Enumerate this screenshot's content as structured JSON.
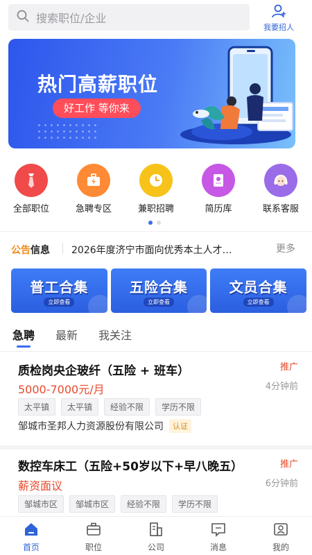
{
  "search": {
    "placeholder": "搜索职位/企业"
  },
  "recruit": {
    "label": "我要招人"
  },
  "banner": {
    "title": "热门高薪职位",
    "slogan": "好工作 等你来"
  },
  "categories": [
    {
      "label": "全部职位",
      "icon": "tie-icon",
      "color": "#f04a4a"
    },
    {
      "label": "急聘专区",
      "icon": "briefcase-bolt-icon",
      "color": "#ff8a35"
    },
    {
      "label": "兼职招聘",
      "icon": "clock-icon",
      "color": "#f7c31a"
    },
    {
      "label": "简历库",
      "icon": "resume-icon",
      "color": "#c757e5"
    },
    {
      "label": "联系客服",
      "icon": "headset-icon",
      "color": "#9b6ce8"
    }
  ],
  "notice": {
    "brand_a": "公告",
    "brand_b": "信息",
    "text": "2026年度济宁市面向优秀本土人才…",
    "more": "更多"
  },
  "collections": [
    {
      "title": "普工合集",
      "sub": "立即查看"
    },
    {
      "title": "五险合集",
      "sub": "立即查看"
    },
    {
      "title": "文员合集",
      "sub": "立即查看"
    }
  ],
  "tabs": [
    "急聘",
    "最新",
    "我关注"
  ],
  "jobs": [
    {
      "name": "质检岗央企玻纤（五险 + 班车）",
      "promo": "推广",
      "salary": "5000-7000元/月",
      "time": "4分钟前",
      "tags": [
        "太平镇",
        "太平镇",
        "经验不限",
        "学历不限"
      ],
      "company": "邹城市圣邦人力资源股份有限公司",
      "badge": "认证"
    },
    {
      "name": "数控车床工（五险+50岁以下+早八晚五）",
      "promo": "推广",
      "salary": "薪资面议",
      "time": "6分钟前",
      "tags": [
        "邹城市区",
        "邹城市区",
        "经验不限",
        "学历不限"
      ]
    }
  ],
  "nav": [
    {
      "label": "首页",
      "icon": "home-icon"
    },
    {
      "label": "职位",
      "icon": "briefcase-icon"
    },
    {
      "label": "公司",
      "icon": "building-icon"
    },
    {
      "label": "消息",
      "icon": "message-icon"
    },
    {
      "label": "我的",
      "icon": "profile-icon"
    }
  ],
  "colors": {
    "accent": "#2f63d8",
    "price": "#e94a2c"
  }
}
